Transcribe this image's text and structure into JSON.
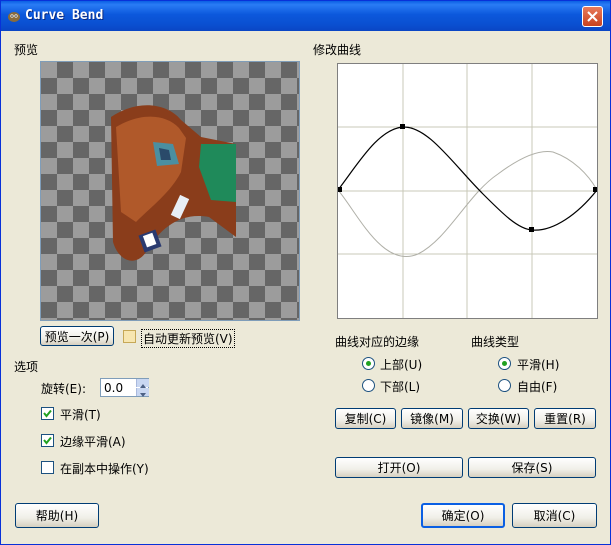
{
  "window": {
    "title": "Curve Bend"
  },
  "colors": {
    "titlebar": "#0a5fe3",
    "face": "#ece9d8",
    "radio_dot": "#21a121",
    "check": "#21a121"
  },
  "preview": {
    "label": "预览",
    "preview_once_button": "预览一次(P)",
    "auto_update_label": "自动更新预览(V)",
    "auto_update_checked": false
  },
  "curve": {
    "label": "修改曲线"
  },
  "edge": {
    "label": "曲线对应的边缘",
    "options": [
      "上部(U)",
      "下部(L)"
    ],
    "selected": "上部(U)"
  },
  "curve_type": {
    "label": "曲线类型",
    "options": [
      "平滑(H)",
      "自由(F)"
    ],
    "selected": "平滑(H)"
  },
  "curve_buttons": {
    "copy": "复制(C)",
    "mirror": "镜像(M)",
    "swap": "交换(W)",
    "reset": "重置(R)"
  },
  "file_buttons": {
    "open": "打开(O)",
    "save": "保存(S)"
  },
  "options": {
    "label": "选项",
    "rotate_label": "旋转(E):",
    "rotate_value": "0.0",
    "smooth_label": "平滑(T)",
    "smooth_checked": true,
    "antialias_label": "边缘平滑(A)",
    "antialias_checked": true,
    "work_on_copy_label": "在副本中操作(Y)",
    "work_on_copy_checked": false
  },
  "footer": {
    "help": "帮助(H)",
    "ok": "确定(O)",
    "cancel": "取消(C)"
  }
}
